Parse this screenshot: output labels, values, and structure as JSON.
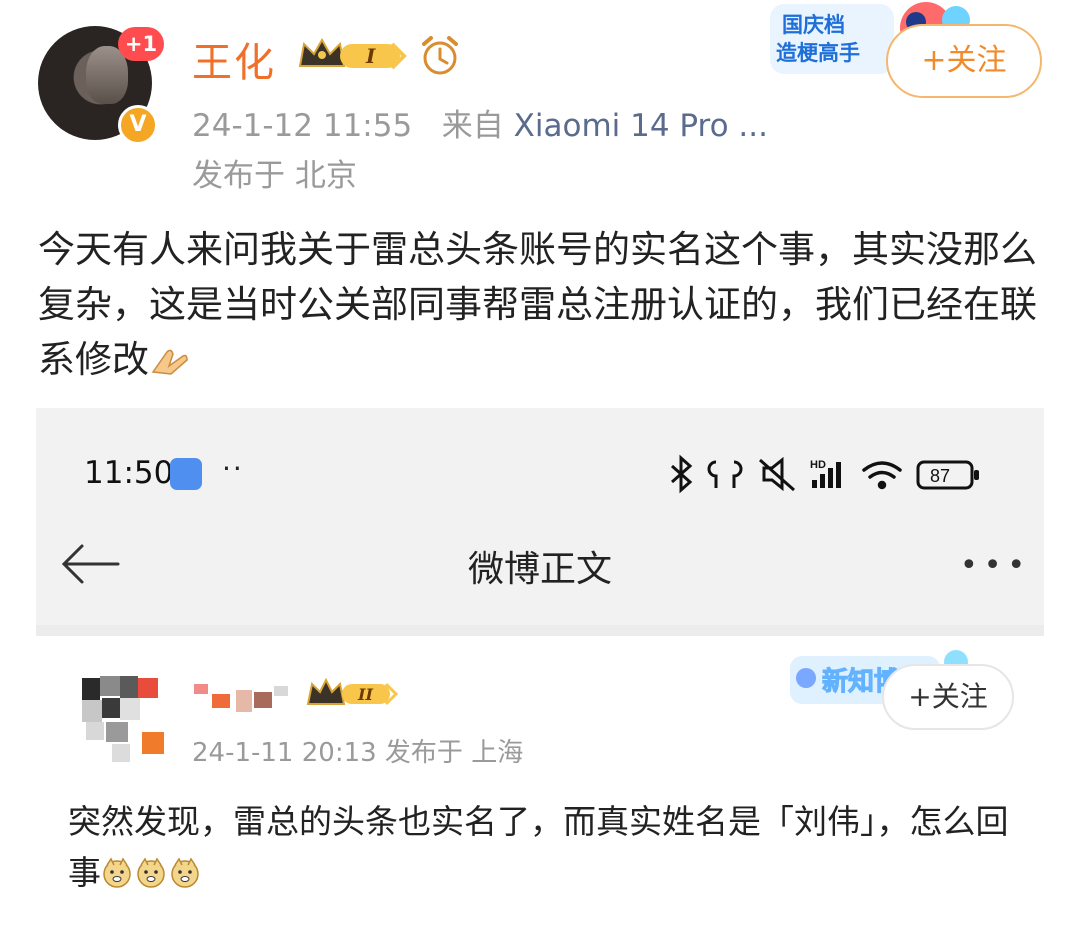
{
  "post": {
    "avatar_badge": "+1",
    "verified_mark": "V",
    "username": "王化",
    "vip_level": "I",
    "promo_banner_text": [
      "国庆档",
      "造梗高手"
    ],
    "follow_label": "+关注",
    "date_time": "24-1-12 11:55",
    "source_prefix": "来自",
    "source_device": "Xiaomi 14 Pro ...",
    "location": "发布于 北京",
    "body": "今天有人来问我关于雷总头条账号的实名这个事，其实没那么复杂，这是当时公关部同事帮雷总注册认证的，我们已经在联系修改"
  },
  "screenshot": {
    "status_time": "11:50",
    "status_dots": "··",
    "battery": "87",
    "nav_title": "微博正文",
    "nav_more": "•••",
    "inner_post": {
      "vip_level": "II",
      "banner_text": "新知博",
      "follow_label": "+关注",
      "meta": "24-1-11 20:13  发布于 上海",
      "body": "突然发现，雷总的头条也实名了，而真实姓名是「刘伟」，怎么回事"
    }
  },
  "colors": {
    "username": "#f0702a",
    "follow_border": "#f5b66e",
    "meta_gray": "#9a9a9a",
    "source_blue": "#5a6b8e"
  }
}
